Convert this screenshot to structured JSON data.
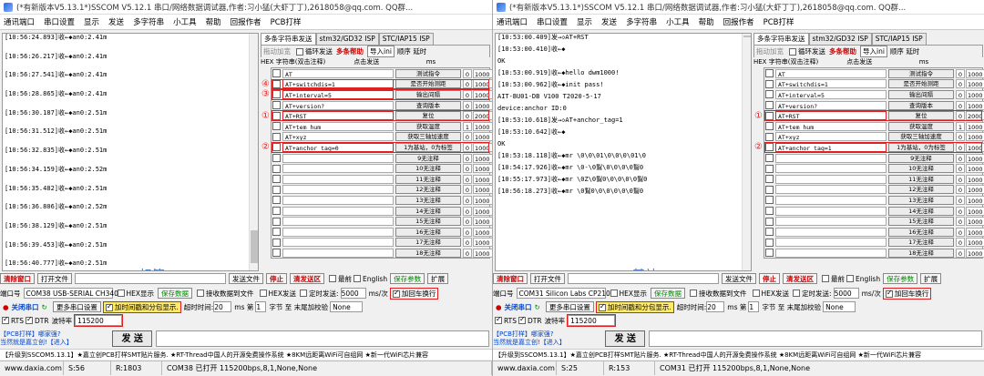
{
  "left": {
    "title": "(*有新版本V5.13.1*)SSCOM V5.12.1 串口/网络数据调试器,作者:习小猛(大虾丁丁),2618058@qq.com. QQ群...",
    "menu": [
      "通讯端口",
      "串口设置",
      "显示",
      "发送",
      "多字符串",
      "小工具",
      "帮助",
      "回报作者",
      "PCB打样"
    ],
    "log": [
      "[10:56:24.893]收←◆an0:2.41m",
      "[10:56:26.217]收←◆an0:2.41m",
      "[10:56:27.541]收←◆an0:2.41m",
      "[10:56:28.865]收←◆an0:2.41m",
      "[10:56:30.187]收←◆an0:2.51m",
      "[10:56:31.512]收←◆an0:2.51m",
      "[10:56:32.835]收←◆an0:2.51m",
      "[10:56:34.159]收←◆an0:2.52m",
      "[10:56:35.482]收←◆an0:2.51m",
      "[10:56:36.806]收←◆an0:2.52m",
      "[10:56:38.129]收←◆an0:2.51m",
      "[10:56:39.453]收←◆an0:2.51m",
      "[10:56:40.777]收←◆an0:2.51m",
      "[10:56:42.101]收←◆an0:2.51m",
      "[10:56:43.424]收←◆an0:2.51m"
    ],
    "overlay_label": "标签",
    "rows": [
      {
        "cmd": "AT",
        "btn": "测试指令",
        "ord": "0",
        "delay": "1000"
      },
      {
        "cmd": "AT+switchdis=1",
        "btn": "是否开始测距",
        "ord": "0",
        "delay": "1000",
        "mark": "④",
        "hl": true
      },
      {
        "cmd": "AT+interval=5",
        "btn": "输出间隔",
        "ord": "0",
        "delay": "1000",
        "mark": "③",
        "hl": true
      },
      {
        "cmd": "AT+version?",
        "btn": "查询版本",
        "ord": "0",
        "delay": "1000"
      },
      {
        "cmd": "AT+RST",
        "btn": "复位",
        "ord": "0",
        "delay": "2000",
        "mark": "①",
        "hl": true
      },
      {
        "cmd": "AT+tem_hum",
        "btn": "获取温度",
        "ord": "1",
        "delay": "1000"
      },
      {
        "cmd": "AT+xyz",
        "btn": "获取三轴加速度",
        "ord": "0",
        "delay": "1000"
      },
      {
        "cmd": "AT+anchor_tag=0",
        "btn": "1为基站，0为标签",
        "ord": "0",
        "delay": "1000",
        "mark": "②",
        "hl": true
      },
      {
        "cmd": "",
        "btn": "9无注释",
        "ord": "0",
        "delay": "1000"
      },
      {
        "cmd": "",
        "btn": "10无注释",
        "ord": "0",
        "delay": "1000"
      },
      {
        "cmd": "",
        "btn": "11无注释",
        "ord": "0",
        "delay": "1000"
      },
      {
        "cmd": "",
        "btn": "12无注释",
        "ord": "0",
        "delay": "1000"
      },
      {
        "cmd": "",
        "btn": "13无注释",
        "ord": "0",
        "delay": "1000"
      },
      {
        "cmd": "",
        "btn": "14无注释",
        "ord": "0",
        "delay": "1000"
      },
      {
        "cmd": "",
        "btn": "15无注释",
        "ord": "0",
        "delay": "1000"
      },
      {
        "cmd": "",
        "btn": "16无注释",
        "ord": "0",
        "delay": "1000"
      },
      {
        "cmd": "",
        "btn": "17无注释",
        "ord": "0",
        "delay": "1000"
      },
      {
        "cmd": "",
        "btn": "18无注释",
        "ord": "0",
        "delay": "1000"
      }
    ],
    "port": "COM38 USB-SERIAL CH340",
    "baud": "115200",
    "status": [
      "www.daxia.com",
      "S:56",
      "R:1803",
      "COM38 已打开  115200bps,8,1,None,None"
    ]
  },
  "right": {
    "title": "(*有新版本V5.13.1*)SSCOM V5.12.1 串口/网络数据调试器,作者:习小猛(大虾丁丁),2618058@qq.com. QQ群...",
    "menu": [
      "通讯端口",
      "串口设置",
      "显示",
      "发送",
      "多字符串",
      "小工具",
      "帮助",
      "回报作者",
      "PCB打样"
    ],
    "log": [
      "[10:53:00.409]发→◇AT+RST",
      "[10:53:00.410]收←◆",
      "OK",
      "[10:53:00.919]收←◆hello dwm1000!",
      "[10:53:00.962]收←◆init pass!",
      "AIT-BU01-DB V100 T2020-5-17",
      "device:anchor ID:0",
      "[10:53:10.618]发→◇AT+anchor_tag=1",
      "[10:53:10.642]收←◆",
      "OK",
      "[10:53:18.118]收←◆mr \\0\\0\\01\\0\\0\\0\\01\\0",
      "[10:54:17.926]收←◆mr \\0-\\0鴷\\0\\0\\0\\0鴷0",
      "[10:55:17.973]收←◆mr \\0Z\\0鴷0\\0\\0\\0\\0鴷0",
      "[10:56:18.273]收←◆mr \\0鴷0\\0\\0\\0\\0\\0鴷0"
    ],
    "overlay_label": "基站",
    "rows": [
      {
        "cmd": "AT",
        "btn": "测试指令",
        "ord": "0",
        "delay": "1000"
      },
      {
        "cmd": "AT+switchdis=1",
        "btn": "是否开始测距",
        "ord": "0",
        "delay": "1000"
      },
      {
        "cmd": "AT+interval=5",
        "btn": "输出间隔",
        "ord": "0",
        "delay": "1000"
      },
      {
        "cmd": "AT+version?",
        "btn": "查询版本",
        "ord": "0",
        "delay": "1000"
      },
      {
        "cmd": "AT+RST",
        "btn": "复位",
        "ord": "0",
        "delay": "2000",
        "mark": "①",
        "hl": true
      },
      {
        "cmd": "AT+tem_hum",
        "btn": "获取温度",
        "ord": "1",
        "delay": "1000"
      },
      {
        "cmd": "AT+xyz",
        "btn": "获取三轴加速度",
        "ord": "0",
        "delay": "1000"
      },
      {
        "cmd": "AT+anchor_tag=1",
        "btn": "1为基站，0为标签",
        "ord": "0",
        "delay": "1000",
        "mark": "②",
        "hl": true
      },
      {
        "cmd": "",
        "btn": "9无注释",
        "ord": "0",
        "delay": "1000"
      },
      {
        "cmd": "",
        "btn": "10无注释",
        "ord": "0",
        "delay": "1000"
      },
      {
        "cmd": "",
        "btn": "11无注释",
        "ord": "0",
        "delay": "1000"
      },
      {
        "cmd": "",
        "btn": "12无注释",
        "ord": "0",
        "delay": "1000"
      },
      {
        "cmd": "",
        "btn": "13无注释",
        "ord": "0",
        "delay": "1000"
      },
      {
        "cmd": "",
        "btn": "14无注释",
        "ord": "0",
        "delay": "1000"
      },
      {
        "cmd": "",
        "btn": "15无注释",
        "ord": "0",
        "delay": "1000"
      },
      {
        "cmd": "",
        "btn": "16无注释",
        "ord": "0",
        "delay": "1000"
      },
      {
        "cmd": "",
        "btn": "17无注释",
        "ord": "0",
        "delay": "1000"
      },
      {
        "cmd": "",
        "btn": "18无注释",
        "ord": "0",
        "delay": "1000"
      }
    ],
    "port": "COM31 Silicon Labs CP210x",
    "baud": "115200",
    "status": [
      "www.daxia.com",
      "S:25",
      "R:153",
      "COM31 已打开  115200bps,8,1,None,None"
    ]
  },
  "common": {
    "tabs": [
      "多条字符串发送",
      "stm32/GD32 ISP",
      "STC/IAP15 ISP"
    ],
    "side_tool": {
      "dim": "拖动加宽",
      "loop": "循环发送",
      "multi": "多条帮助",
      "import": "导入ini",
      "order": "顺序",
      "delay": "延时"
    },
    "header": {
      "hex": "HEX",
      "strcol": "字符串(双击注释)",
      "clicksend": "点击发送",
      "ms": "ms"
    },
    "clear_window": "清除窗口",
    "open_file": "打开文件",
    "send_file": "发送文件",
    "stop": "停止",
    "clear_send": "清发送区",
    "topmost": "最前",
    "english": "English",
    "save_params": "保存参数",
    "expand": "扩展",
    "port_label": "端口号",
    "hex_show": "HEX显示",
    "save_data": "保存数据",
    "recv_to_file": "接收数据到文件",
    "hex_send": "HEX发送",
    "timed_send": "定时发送:",
    "interval": "5000",
    "ms_per": "ms/次",
    "add_crlf": "加回车换行",
    "close_port": "关闭串口",
    "more_settings": "更多串口设置",
    "add_timestamp": "加时间戳和分包显示.",
    "timeout": "超时时间:",
    "timeout_val": "20",
    "ms": "ms",
    "nth": "第",
    "nth_val": "1",
    "byte_to_end": "字节 至",
    "end": "末尾",
    "verify": "加校验",
    "verify_val": "None",
    "rts": "RTS",
    "dtr": "DTR",
    "baud_label": "波特率",
    "send": "发 送",
    "promo1": "【PCB打样】哪家强?",
    "promo2": "当然就是嘉立创!【进入】",
    "ticker": "【升级到SSCOM5.13.1】★嘉立创PCB打样SMT贴片服务. ★RT-Thread中国人的开源免费操作系统 ★8KM远距离WiFi可自组网 ★新一代WiFi芯片兼容"
  }
}
